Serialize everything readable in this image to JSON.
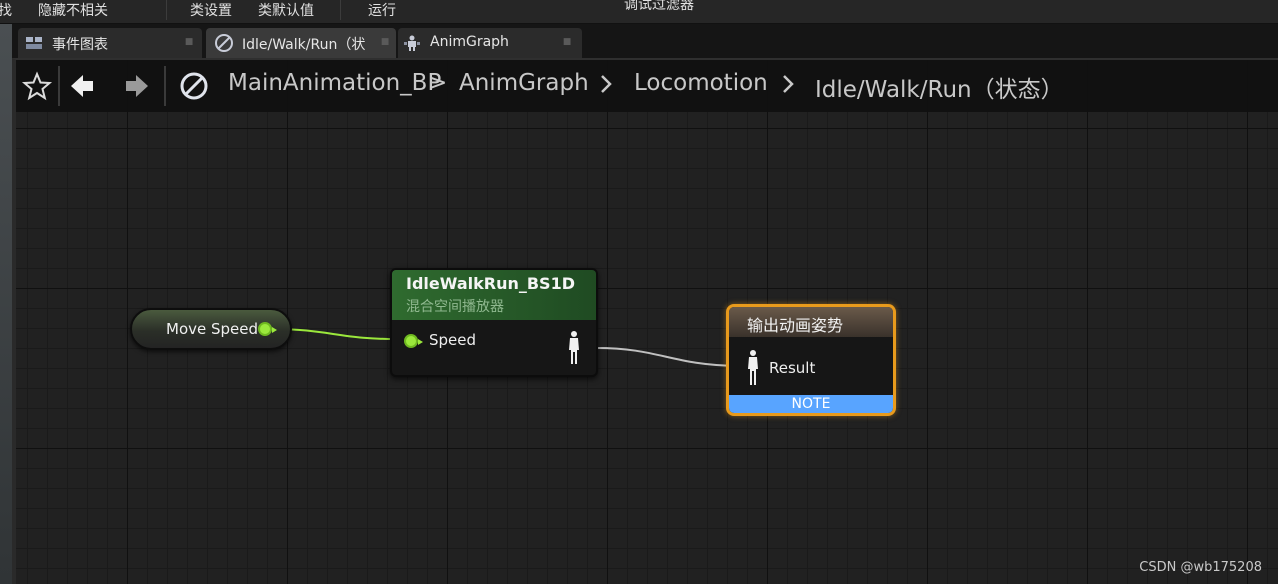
{
  "toolbar": {
    "items": [
      "找",
      "隐藏不相关",
      "类设置",
      "类默认值",
      "运行",
      "调试过滤器"
    ]
  },
  "tabs": [
    {
      "label": "事件图表",
      "icon": "event-graph-icon",
      "active": false
    },
    {
      "label": "Idle/Walk/Run（状",
      "icon": "state-icon",
      "active": true
    },
    {
      "label": "AnimGraph",
      "icon": "anim-graph-icon",
      "active": false
    }
  ],
  "breadcrumb": {
    "items": [
      "MainAnimation_BP",
      "AnimGraph",
      "Locomotion",
      "Idle/Walk/Run（状态）"
    ],
    "separators": [
      ">",
      ">",
      ">"
    ]
  },
  "nodes": {
    "move_speed": {
      "label": "Move Speed",
      "color": "#9be83c"
    },
    "blendspace": {
      "title": "IdleWalkRun_BS1D",
      "subtitle": "混合空间播放器",
      "input_pin": "Speed",
      "header_color": "#2f6b2f"
    },
    "output_pose": {
      "title": "输出动画姿势",
      "pin": "Result",
      "note": "NOTE",
      "border_color": "#e89a1c",
      "note_color": "#58a4ff"
    }
  },
  "watermark": "CSDN @wb175208"
}
